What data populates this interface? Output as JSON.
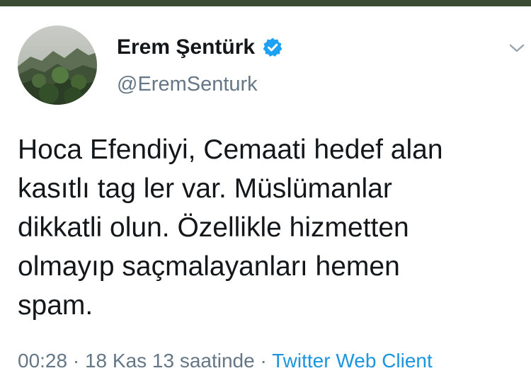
{
  "author": {
    "name": "Erem Şentürk",
    "handle": "@EremSenturk",
    "verified_icon": "verified-badge-icon",
    "accent_color": "#1da1f2"
  },
  "tweet": {
    "lines": [
      "Hoca Efendiyi, Cemaati hedef alan",
      "kasıtlı tag ler var. Müslümanlar",
      "dikkatli olun. Özellikle hizmetten",
      "olmayıp saçmalayanları hemen",
      "spam."
    ]
  },
  "meta": {
    "time": "00:28",
    "date": "18 Kas 13 saatinde",
    "separator": "·",
    "source": "Twitter Web Client"
  },
  "icons": {
    "menu": "chevron-down-icon"
  }
}
